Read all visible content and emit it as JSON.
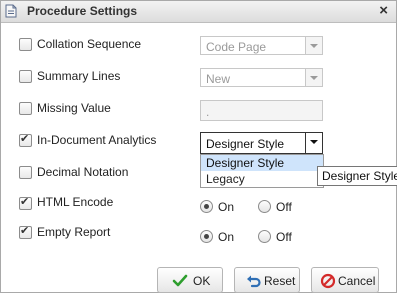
{
  "dialog": {
    "title": "Procedure Settings",
    "close_glyph": "×"
  },
  "rows": {
    "collation": {
      "label": "Collation Sequence",
      "checked": false,
      "value": "Code Page"
    },
    "summary": {
      "label": "Summary Lines",
      "checked": false,
      "value": "New"
    },
    "missing": {
      "label": "Missing Value",
      "checked": false,
      "value": "."
    },
    "analytics": {
      "label": "In-Document Analytics",
      "checked": true,
      "value": "Designer Style"
    },
    "decimal": {
      "label": "Decimal Notation",
      "checked": false
    },
    "html_encode": {
      "label": "HTML Encode",
      "checked": true,
      "on": "On",
      "off": "Off",
      "selected": "On"
    },
    "empty_report": {
      "label": "Empty Report",
      "checked": true,
      "on": "On",
      "off": "Off",
      "selected": "On"
    }
  },
  "dropdown": {
    "options": [
      "Designer Style",
      "Legacy"
    ],
    "highlighted": "Designer Style"
  },
  "tooltip": {
    "text": "Designer Style"
  },
  "buttons": {
    "ok": "OK",
    "reset": "Reset",
    "cancel": "Cancel"
  },
  "colors": {
    "ok_icon": "#2e9e2e",
    "reset_icon": "#2f6fb5",
    "cancel_icon": "#d42a2a",
    "highlight": "#cfe4fb"
  }
}
